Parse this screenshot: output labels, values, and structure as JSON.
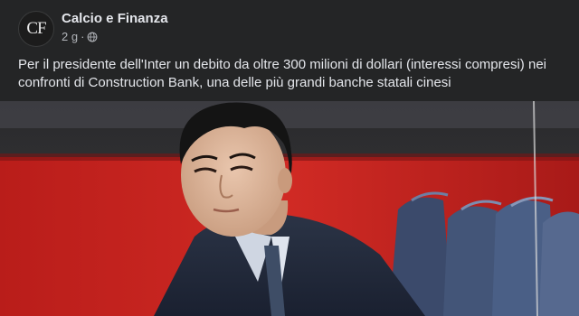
{
  "post": {
    "page": {
      "name": "Calcio e Finanza",
      "avatar_text": "CF"
    },
    "timestamp": "2 g",
    "separator": "·",
    "audience_icon": "globe-icon",
    "caption": "Per il presidente dell'Inter un debito da oltre 300 milioni di dollari (interessi compresi) nei confronti di Construction Bank, una delle più grandi banche statali cinesi",
    "photo": {
      "description_icon": "photo-stadium-portrait"
    }
  },
  "colors": {
    "background": "#242526",
    "text_primary": "#e4e6eb",
    "text_secondary": "#b0b3b8",
    "stadium_red": "#c8231f"
  }
}
